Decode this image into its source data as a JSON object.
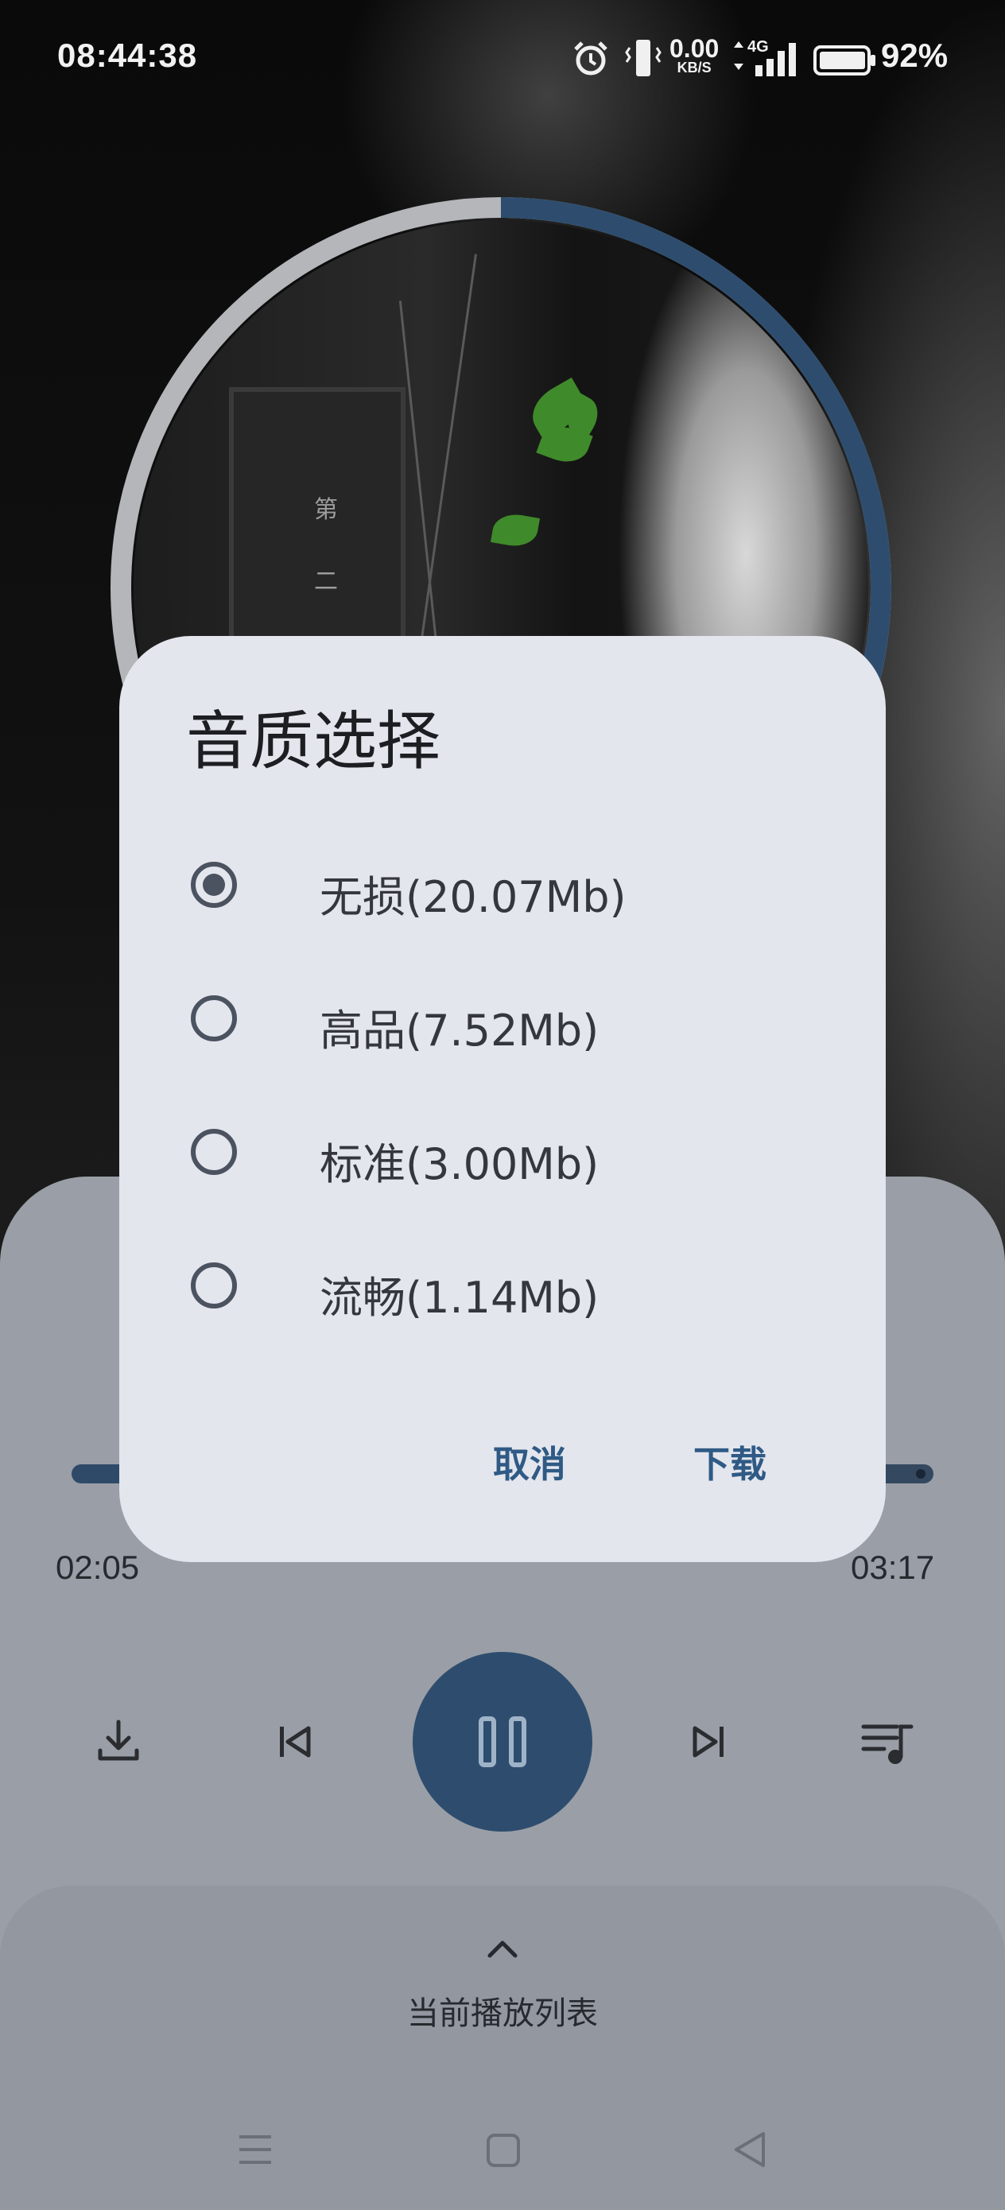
{
  "status_bar": {
    "time": "08:44:38",
    "net_speed_value": "0.00",
    "net_speed_unit": "KB/S",
    "network_type": "4G",
    "battery_percent": "92%"
  },
  "album": {
    "board_text": "第二街",
    "progress_ring_fraction": 0.33
  },
  "player": {
    "current_time": "02:05",
    "total_time": "03:17",
    "progress_fraction": 0.63
  },
  "playlist": {
    "label": "当前播放列表"
  },
  "dialog": {
    "title": "音质选择",
    "options": [
      {
        "label": "无损(20.07Mb)",
        "selected": true
      },
      {
        "label": "高品(7.52Mb)",
        "selected": false
      },
      {
        "label": "标准(3.00Mb)",
        "selected": false
      },
      {
        "label": "流畅(1.14Mb)",
        "selected": false
      }
    ],
    "cancel_label": "取消",
    "confirm_label": "下载"
  },
  "colors": {
    "accent": "#2e4d6e",
    "dialog_bg": "#e4e6ed",
    "panel_bg": "#9a9ea6"
  },
  "icons": {
    "download": "download-icon",
    "previous": "skip-previous-icon",
    "pause": "pause-icon",
    "next": "skip-next-icon",
    "queue": "queue-music-icon",
    "expand": "chevron-up-icon"
  }
}
